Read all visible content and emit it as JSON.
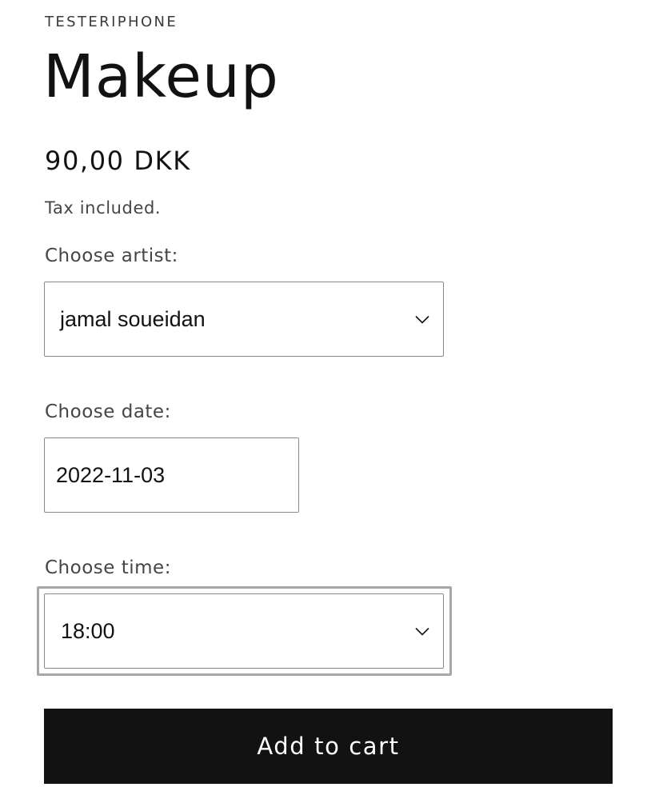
{
  "product": {
    "vendor": "TESTERIPHONE",
    "title": "Makeup",
    "price": "90,00 DKK",
    "tax_note": "Tax included."
  },
  "form": {
    "artist": {
      "label": "Choose artist:",
      "value": "jamal soueidan"
    },
    "date": {
      "label": "Choose date:",
      "value": "2022-11-03"
    },
    "time": {
      "label": "Choose time:",
      "value": "18:00"
    }
  },
  "actions": {
    "add_to_cart_label": "Add to cart"
  },
  "icons": {
    "select_chevron": "chevron-down-icon"
  },
  "colors": {
    "button_bg": "#121212",
    "button_text": "#ffffff",
    "border": "#8a8a8a",
    "focus_ring": "#a7a7a7"
  }
}
